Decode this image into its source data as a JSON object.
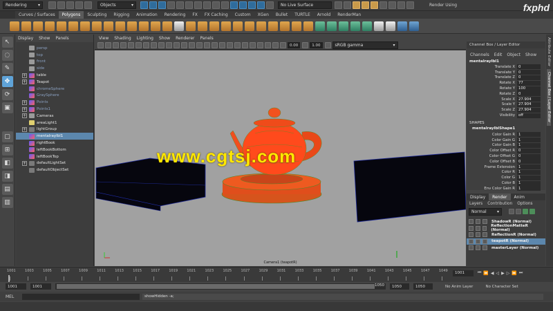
{
  "status": {
    "menuset": "Rendering",
    "selection_mode": "Objects",
    "live_surface": "No Live Surface",
    "render_label": "Render Using"
  },
  "shelf_tabs": [
    "Curves / Surfaces",
    "Polygons",
    "Sculpting",
    "Rigging",
    "Animation",
    "Rendering",
    "FX",
    "FX Caching",
    "Custom",
    "XGen",
    "Bullet",
    "TURTLE",
    "Arnold",
    "RenderMan"
  ],
  "active_shelf_tab": "Polygons",
  "outliner": {
    "menu": [
      "Display",
      "Show",
      "Panels"
    ],
    "items": [
      {
        "label": "persp",
        "icon": "camera-icon",
        "expand": "",
        "state": "dim"
      },
      {
        "label": "top",
        "icon": "camera-icon",
        "expand": "",
        "state": "dim"
      },
      {
        "label": "front",
        "icon": "camera-icon",
        "expand": "",
        "state": "dim"
      },
      {
        "label": "side",
        "icon": "camera-icon",
        "expand": "",
        "state": "dim"
      },
      {
        "label": "table",
        "icon": "mesh-icon",
        "expand": "+",
        "state": ""
      },
      {
        "label": "Teapot",
        "icon": "mesh-icon",
        "expand": "+",
        "state": ""
      },
      {
        "label": "chromeSphere",
        "icon": "mesh-icon",
        "expand": "",
        "state": "dim"
      },
      {
        "label": "GraySphere",
        "icon": "mesh-icon",
        "expand": "",
        "state": "dim"
      },
      {
        "label": "Points",
        "icon": "mesh-icon",
        "expand": "+",
        "state": "dim"
      },
      {
        "label": "Points1",
        "icon": "mesh-icon",
        "expand": "+",
        "state": "dim"
      },
      {
        "label": "Cameras",
        "icon": "camera-icon",
        "expand": "+",
        "state": ""
      },
      {
        "label": "areaLight1",
        "icon": "light-icon",
        "expand": "",
        "state": ""
      },
      {
        "label": "lightGroup",
        "icon": "group-icon",
        "expand": "+",
        "state": ""
      },
      {
        "label": "mentalraylbl1",
        "icon": "mesh-icon",
        "expand": "",
        "state": "sel"
      },
      {
        "label": "rightBook",
        "icon": "mesh-icon",
        "expand": "",
        "state": ""
      },
      {
        "label": "leftBookBottom",
        "icon": "mesh-icon",
        "expand": "",
        "state": ""
      },
      {
        "label": "leftBookTop",
        "icon": "mesh-icon",
        "expand": "",
        "state": ""
      },
      {
        "label": "defaultLightSet",
        "icon": "set-icon",
        "expand": "+",
        "state": ""
      },
      {
        "label": "defaultObjectSet",
        "icon": "set-icon",
        "expand": "",
        "state": ""
      }
    ]
  },
  "viewport": {
    "menu": [
      "View",
      "Shading",
      "Lighting",
      "Show",
      "Renderer",
      "Panels"
    ],
    "exposure": "0.00",
    "gamma": "1.00",
    "colorspace": "sRGB gamma",
    "camera_label": "Camera1 (teapotR)",
    "watermark": "www.cgtsj.com",
    "logo": "fxphd"
  },
  "channel_box": {
    "title": "Channel Box / Layer Editor",
    "menu": [
      "Channels",
      "Edit",
      "Object",
      "Show"
    ],
    "object": "mentalraylbl1",
    "attributes": [
      {
        "label": "Translate X",
        "value": "0"
      },
      {
        "label": "Translate Y",
        "value": "0"
      },
      {
        "label": "Translate Z",
        "value": "0"
      },
      {
        "label": "Rotate X",
        "value": "77"
      },
      {
        "label": "Rotate Y",
        "value": "100"
      },
      {
        "label": "Rotate Z",
        "value": "0"
      },
      {
        "label": "Scale X",
        "value": "27.904"
      },
      {
        "label": "Scale Y",
        "value": "27.904"
      },
      {
        "label": "Scale Z",
        "value": "27.904"
      },
      {
        "label": "Visibility",
        "value": "off"
      }
    ],
    "shapes_header": "SHAPES",
    "shape_name": "mentalraylblShape1",
    "shape_attributes": [
      {
        "label": "Color Gain R",
        "value": "1"
      },
      {
        "label": "Color Gain G",
        "value": "1"
      },
      {
        "label": "Color Gain B",
        "value": "1"
      },
      {
        "label": "Color Offset R",
        "value": "0"
      },
      {
        "label": "Color Offset G",
        "value": "0"
      },
      {
        "label": "Color Offset B",
        "value": "0"
      },
      {
        "label": "Frame Extension",
        "value": "1"
      },
      {
        "label": "Color R",
        "value": "1"
      },
      {
        "label": "Color G",
        "value": "1"
      },
      {
        "label": "Color B",
        "value": "1"
      },
      {
        "label": "Env Color Gain R",
        "value": "1"
      }
    ]
  },
  "side_tabs": [
    "Attribute Editor",
    "Channel Box / Layer Editor"
  ],
  "layer_editor": {
    "tabs": [
      "Display",
      "Render",
      "Anim"
    ],
    "active_tab": "Render",
    "menu": [
      "Layers",
      "Contribution",
      "Options"
    ],
    "mode": "Normal",
    "layers": [
      {
        "name": "ShadowR (Normal)",
        "selected": false
      },
      {
        "name": "ReflectionMatteR (Normal)",
        "selected": false
      },
      {
        "name": "ReflectionR (Normal)",
        "selected": false
      },
      {
        "name": "teapotR (Normal)",
        "selected": true
      },
      {
        "name": "masterLayer (Normal)",
        "selected": false
      }
    ]
  },
  "timeline": {
    "ticks": [
      "1001",
      "1003",
      "1005",
      "1007",
      "1009",
      "1011",
      "1013",
      "1015",
      "1017",
      "1019",
      "1021",
      "1023",
      "1025",
      "1027",
      "1029",
      "1031",
      "1033",
      "1035",
      "1037",
      "1039",
      "1041",
      "1043",
      "1045",
      "1047",
      "1049"
    ],
    "current_frame": "1001",
    "frame_field": "1001"
  },
  "range": {
    "start": "1001",
    "start_inner": "1001",
    "end_inner": "1050",
    "end_range": "1050",
    "end": "1050",
    "anim_layer": "No Anim Layer",
    "character_set": "No Character Set"
  },
  "command": {
    "lang": "MEL",
    "result": "showHidden -a;"
  },
  "colors": {
    "teapot": "#ff4a1c",
    "viewport_bg": "#a1a1a1",
    "selection": "#5c87ad",
    "watermark": "#ffe800"
  }
}
